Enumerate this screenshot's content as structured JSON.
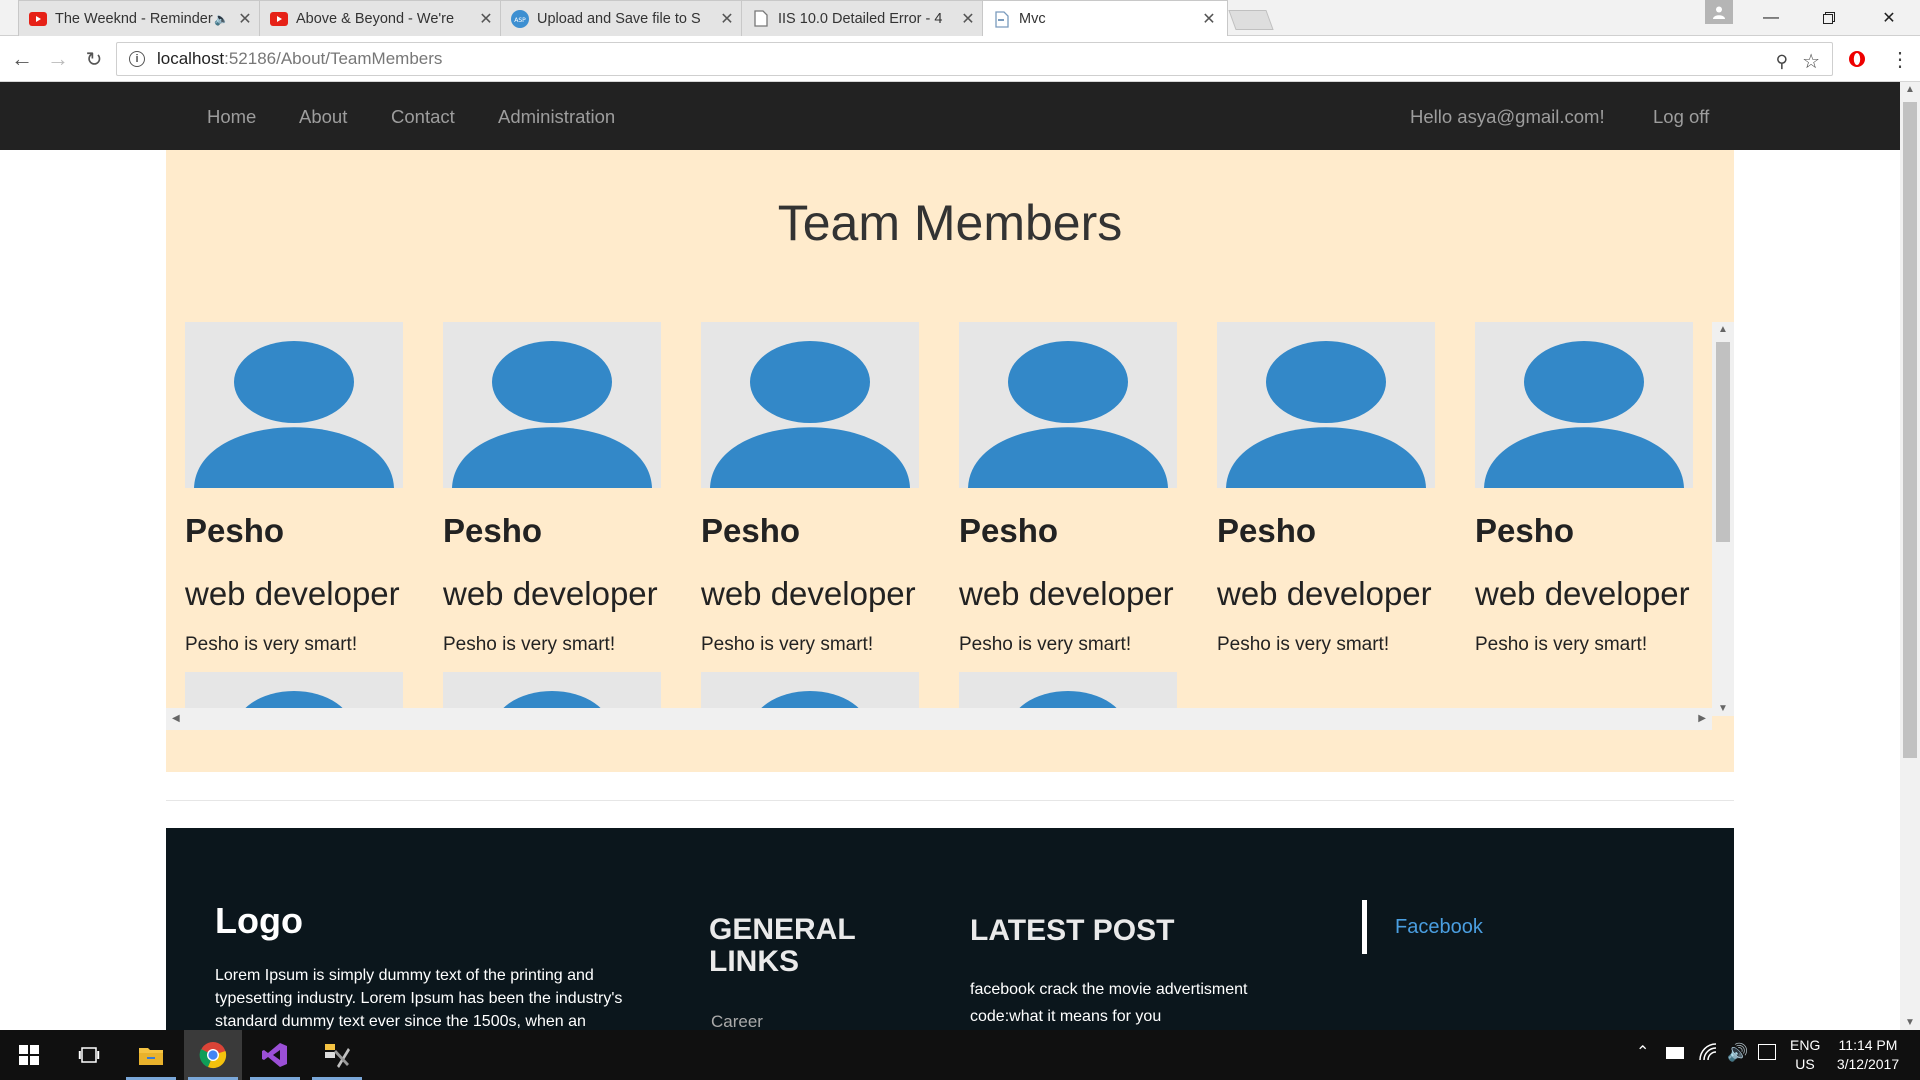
{
  "browser": {
    "tabs": [
      {
        "title": "The Weeknd - Reminder",
        "favicon": "youtube-icon",
        "audio": "speaker-icon"
      },
      {
        "title": "Above & Beyond - We're",
        "favicon": "youtube-icon"
      },
      {
        "title": "Upload and Save file to S",
        "favicon": "asp-icon"
      },
      {
        "title": "IIS 10.0 Detailed Error - 4",
        "favicon": "document-icon"
      },
      {
        "title": "Mvc",
        "favicon": "page-icon"
      }
    ],
    "url_host": "localhost",
    "url_path": ":52186/About/TeamMembers"
  },
  "navbar": {
    "links": [
      "Home",
      "About",
      "Contact",
      "Administration"
    ],
    "greeting": "Hello asya@gmail.com!",
    "logoff": "Log off"
  },
  "main": {
    "title": "Team Members",
    "members": [
      {
        "name": "Pesho",
        "role": "web developer",
        "description": "Pesho is very smart!"
      },
      {
        "name": "Pesho",
        "role": "web developer",
        "description": "Pesho is very smart!"
      },
      {
        "name": "Pesho",
        "role": "web developer",
        "description": "Pesho is very smart!"
      },
      {
        "name": "Pesho",
        "role": "web developer",
        "description": "Pesho is very smart!"
      },
      {
        "name": "Pesho",
        "role": "web developer",
        "description": "Pesho is very smart!"
      },
      {
        "name": "Pesho",
        "role": "web developer",
        "description": "Pesho is very smart!"
      }
    ]
  },
  "footer": {
    "logo": "Logo",
    "lorem": "Lorem Ipsum is simply dummy text of the printing and typesetting industry. Lorem Ipsum has been the industry's standard dummy text ever since the 1500s, when an",
    "general_links_title": "GENERAL LINKS",
    "career": "Career",
    "latest_post_title": "LATEST POST",
    "post": "facebook crack the movie advertisment code:what it means for you",
    "facebook": "Facebook"
  },
  "taskbar": {
    "lang": "ENG",
    "region": "US",
    "time": "11:14 PM",
    "date": "3/12/2017"
  },
  "colors": {
    "avatar_blue": "#3388c8",
    "panel_bg": "#ffebcc",
    "navbar_bg": "#222222",
    "footer_bg": "#0b161c"
  }
}
